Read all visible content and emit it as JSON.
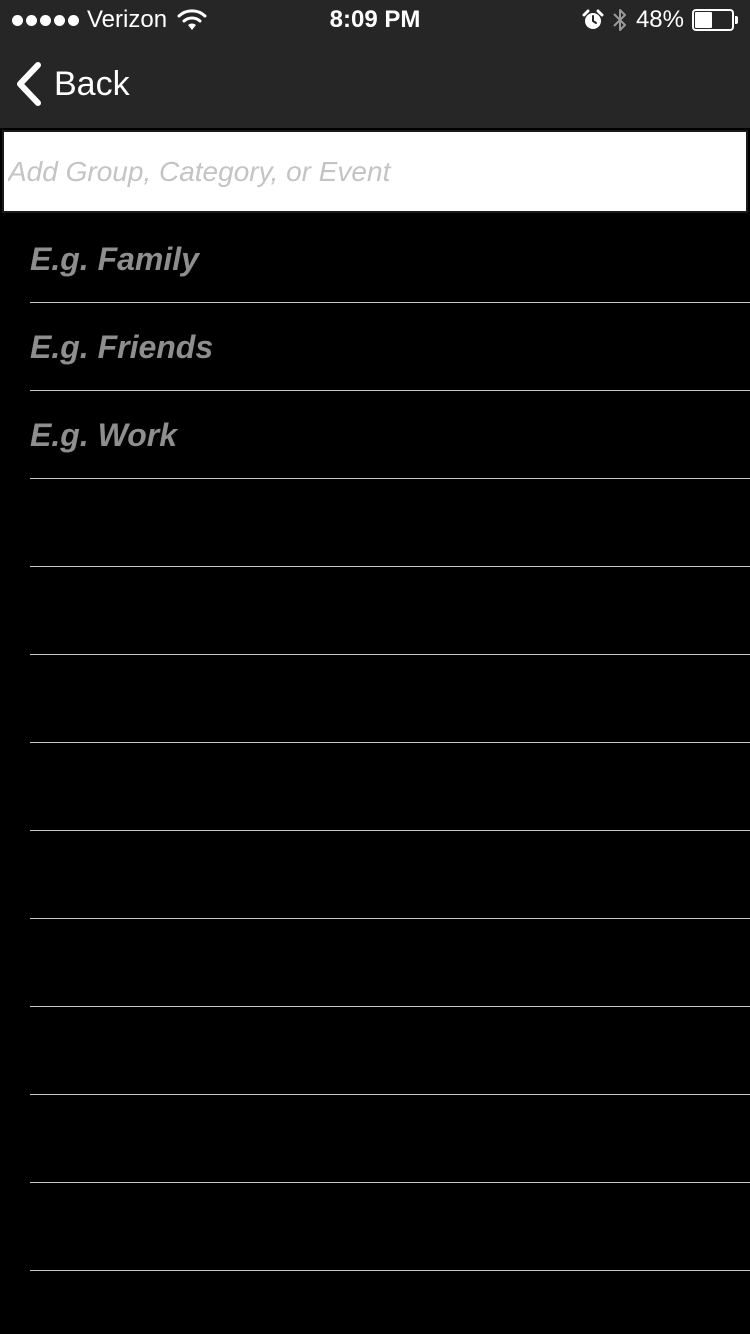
{
  "status_bar": {
    "carrier": "Verizon",
    "time": "8:09 PM",
    "battery_percent": "48%",
    "battery_level": 0.48,
    "signal_dots": 5
  },
  "nav": {
    "back_label": "Back"
  },
  "add_field": {
    "placeholder": "Add Group, Category, or Event",
    "value": ""
  },
  "list": {
    "rows": [
      {
        "label": "E.g. Family"
      },
      {
        "label": "E.g. Friends"
      },
      {
        "label": "E.g. Work"
      },
      {
        "label": ""
      },
      {
        "label": ""
      },
      {
        "label": ""
      },
      {
        "label": ""
      },
      {
        "label": ""
      },
      {
        "label": ""
      },
      {
        "label": ""
      },
      {
        "label": ""
      },
      {
        "label": ""
      }
    ]
  },
  "colors": {
    "bar_background": "#262626",
    "screen_background": "#000000",
    "hint_text": "#8e8e8e",
    "separator": "#c8c8c8"
  }
}
